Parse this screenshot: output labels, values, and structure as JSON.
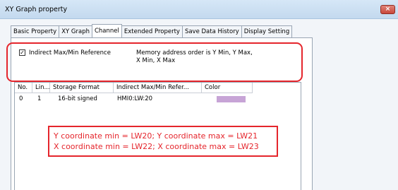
{
  "window": {
    "title": "XY Graph property",
    "close_label": "×"
  },
  "tabs": [
    "Basic Property",
    "XY Graph",
    "Channel",
    "Extended Property",
    "Save Data History",
    "Display Setting"
  ],
  "active_tab": "Channel",
  "indirect": {
    "checked": true,
    "check_glyph": "✓",
    "label": "Indirect Max/Min Reference",
    "note_line1": "Memory address order is Y Min, Y Max,",
    "note_line2": "X Min, X Max"
  },
  "table": {
    "columns": [
      "No.",
      "Lin...",
      "Storage Format",
      "Indirect Max/Min Refer...",
      "Color"
    ],
    "rows": [
      {
        "no": "0",
        "line": "1",
        "format": "16-bit signed",
        "indirect": "HMI0:LW:20",
        "color": "#c7a4d6"
      }
    ]
  },
  "annotation": {
    "line1": "Y coordinate min = LW20; Y coordinate max = LW21",
    "line2": "X coordinate min = LW22; X coordinate max = LW23"
  },
  "colors": {
    "highlight": "#e5252c",
    "titlebar": "#c3d9ee"
  }
}
